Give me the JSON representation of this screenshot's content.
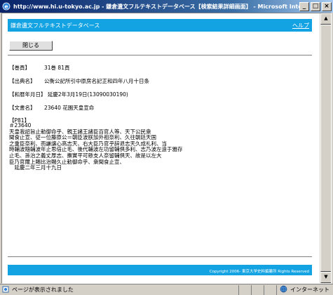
{
  "window": {
    "title": "http://www.hi.u-tokyo.ac.jp - 鎌倉遺文フルテキストデータベース【検索結果詳細画面】 - Microsoft Internet Explorer",
    "minimize": "_",
    "maximize": "□",
    "close": "×"
  },
  "header": {
    "title": "鎌倉遺文フルテキストデータベース",
    "help": "ヘルプ"
  },
  "close_button": "閉じる",
  "fields": {
    "volume_label": "【巻頁】",
    "volume_value": "31巻 81頁",
    "source_label": "【出典名】",
    "source_value": "公衡公記所引中原房名記正和四年八月十日条",
    "date_label": "【和暦年月日】",
    "date_value": "延慶2年3月19日(13090030190)",
    "docname_label": "【文書名】",
    "docname_value": "23640 花園天皇宣命"
  },
  "body": {
    "page": "【P81】",
    "text": "＃23640\n天皇我詔旨止勅御命乎、親王諸王諸臣百官人等、天下公民衆\n聞食止宣、従一位藤原公＝朝臣波朕加外祖奈利、久往朝廷天国\n之重臣奈利、而謙譲心高志天、右大臣乃官乎辞退志天久成礼利、当\n時輔波隨輔波年止思倍止毛、後代輔波左功留輔倶多利、志乃波左遠于雅存\n止毛、孫治之義丈厚志、撫實平可懸支人奈留輔倶天、故是以左大\n臣乃官爾上賜比治賜久止勅御命乎、衆聞食止宣、\n　延慶二年三月十九日"
  },
  "footer": {
    "copyright": "Copyright 2006- 東京大学史料編纂所 Rights Reserved"
  },
  "statusbar": {
    "message": "ページが表示されました",
    "zone": "インターネット"
  },
  "colors": {
    "accent": "#13a3e3",
    "titlebar_start": "#0a246a",
    "titlebar_end": "#a6caf0"
  },
  "icons": {
    "window_icon": "ie-icon",
    "status_icon": "page-icon",
    "zone_icon": "globe-icon"
  }
}
